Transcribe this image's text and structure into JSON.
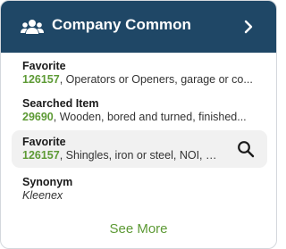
{
  "header": {
    "title": "Company Common",
    "group_icon": "group-icon",
    "chevron_icon": "chevron-right-icon",
    "background_color": "#1f4766"
  },
  "items": [
    {
      "title": "Favorite",
      "code": "126157",
      "description": ", Operators or Openers, garage or co..."
    },
    {
      "title": "Searched Item",
      "code": "29690",
      "description": ", Wooden, bored and turned, finished..."
    },
    {
      "title": "Favorite",
      "code": "126157",
      "description": ", Shingles, iron or steel, NOI, in b...",
      "action_icon": "search-icon"
    },
    {
      "title": "Synonym",
      "subtitle": "Kleenex"
    }
  ],
  "see_more_label": "See More",
  "accent_color": "#5d9a35"
}
